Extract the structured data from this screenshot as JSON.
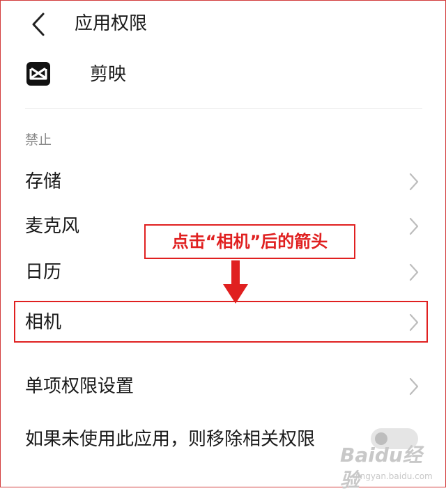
{
  "header": {
    "title": "应用权限"
  },
  "app": {
    "name": "剪映"
  },
  "section": {
    "label": "禁止"
  },
  "rows": [
    {
      "label": "存储"
    },
    {
      "label": "麦克风"
    },
    {
      "label": "日历"
    },
    {
      "label": "相机"
    },
    {
      "label": "单项权限设置"
    }
  ],
  "auto_revoke": {
    "label": "如果未使用此应用，则移除相关权限",
    "toggle_on": false
  },
  "annotation": {
    "text": "点击“相机”后的箭头",
    "color": "#e02020"
  },
  "watermark": {
    "main": "Baidu经验",
    "sub": "jingyan.baidu.com"
  },
  "icons": {
    "back": "chevron-left-icon",
    "row": "chevron-right-icon",
    "app": "capcut-logo-icon",
    "callout_arrow": "arrow-down-icon"
  }
}
